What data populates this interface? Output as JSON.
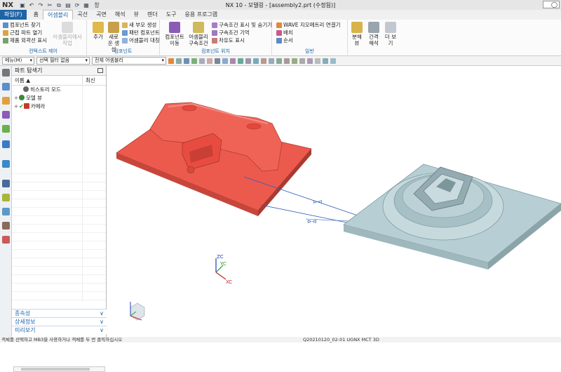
{
  "titlebar": {
    "logo": "NX",
    "title": "NX 10 - 모델링 - [assembly2.prt (수정됨)]",
    "window_menu": "창",
    "search": "◯"
  },
  "tabs": [
    "파일(F)",
    "홈",
    "어셈블리",
    "곡선",
    "곡면",
    "해석",
    "뷰",
    "렌더",
    "도구",
    "응용 프로그램"
  ],
  "active_tab": "어셈블리",
  "ribbon": {
    "context": {
      "items": [
        "컴포넌트 찾기",
        "근접 파트 열기",
        "제품 외곽선 표시"
      ],
      "big": "어셈블리에서 작업",
      "label": "컨텍스트 제어"
    },
    "component": {
      "add": "추가",
      "create_new": "새로운 생성",
      "items": [
        "새 부모 생성",
        "패턴 컴포넌트",
        "어셈블리 대칭"
      ],
      "label": "컴포넌트"
    },
    "position": {
      "move": "컴포넌트 이동",
      "constraint": "어셈블리 구속조건",
      "items": [
        "구속조건 표시 및 숨기기",
        "구속조건 기억",
        "차유도 표시"
      ],
      "label": "컴포넌트 위치"
    },
    "general": {
      "items": [
        "WAVE 지오메트리 연결기",
        "배치",
        "순서"
      ],
      "label": "일반"
    },
    "extra": {
      "explode": "분해 뷰",
      "clearance": "간격 해석",
      "more": "더 보기"
    }
  },
  "toolbar": {
    "menu": "메뉴(M)",
    "filter": "선택 필터 없음",
    "scope": "전체 어셈블리"
  },
  "navigator": {
    "title": "파트 탐색기",
    "col_name": "이름",
    "col_recent": "최신",
    "rows": [
      {
        "label": "히스토리 모드",
        "exp": "",
        "color": "#666666"
      },
      {
        "label": "모델 뷰",
        "exp": "+",
        "color": "#3a8a3a"
      },
      {
        "label": "카메라",
        "exp": "+",
        "color": "#c8382a"
      }
    ],
    "accordions": [
      "종속성",
      "상세정보",
      "미리보기"
    ]
  },
  "viewport": {
    "csys_labels": {
      "zc": "ZC",
      "yc": "YC",
      "xc": "XC"
    },
    "colors": {
      "red_part": "#ec5a4e",
      "blue_part": "#b7cfd4"
    }
  },
  "statusbar": {
    "left": "객체를 선택하고 MB3을 사용하거나 객체를 두 번 클릭하십시오",
    "right": "Q20210120_02-01 UGNX MCT 3D"
  }
}
